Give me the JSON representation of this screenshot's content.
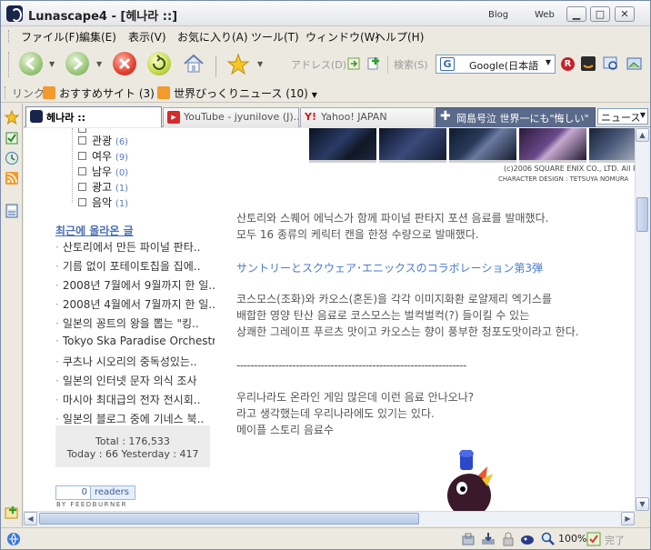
{
  "window": {
    "title": "Lunascape4 - [헤나라 ::]",
    "mode_blog": "Blog",
    "mode_web": "Web",
    "controls": {
      "minimize": "▁",
      "maximize": "□",
      "close": "✕"
    }
  },
  "menu": [
    "ファイル(F)",
    "編集(E)",
    "表示(V)",
    "お気に入り(A)",
    "ツール(T)",
    "ウィンドウ(W)",
    "ヘルプ(H)"
  ],
  "toolbar": {
    "address_label": "アドレス(D)",
    "search_label": "検索(S)",
    "search_engine": "Google(日本語"
  },
  "links": {
    "label": "リンク",
    "items": [
      "おすすめサイト (3)",
      "世界びっくりニュース (10)"
    ]
  },
  "tabs": [
    {
      "label": "헤나라 ::",
      "active": true
    },
    {
      "label": "YouTube - jyunilove (J)...",
      "active": false
    },
    {
      "label": "Yahoo! JAPAN",
      "active": false
    },
    {
      "label": "岡島号泣 世界一にも\"悔しい\"",
      "active": false
    }
  ],
  "news_select": "ニュース",
  "categories": [
    {
      "name": "관광",
      "count": "(6)"
    },
    {
      "name": "여우",
      "count": "(9)"
    },
    {
      "name": "남우",
      "count": "(0)"
    },
    {
      "name": "광고",
      "count": "(1)"
    },
    {
      "name": "음악",
      "count": "(1)"
    }
  ],
  "recent": {
    "title": "최근에 올라온 글",
    "posts": [
      "산토리에서 만든 파이널 판타..",
      "기름 없이 포테이토칩을 집에..",
      "2008년 7월에서 9월까지 한 일..",
      "2008년 4월에서 7월까지 한 일..",
      "일본의 꽁트의 왕을 뽑는 \"킹..",
      "Tokyo Ska Paradise Orchestra",
      "쿠츠나 시오리의 중독성있는..",
      "일본의 인터넷 문자 의식 조사",
      "마시아 최대급의 전자 전시회..",
      "일본의 블로그 중에 기네스 북.."
    ]
  },
  "counter": {
    "total": "Total : 176,533",
    "today": "Today : 66 Yesterday : 417"
  },
  "feedburner": {
    "count": "0",
    "readers": "readers",
    "by": "BY FEEDBURNER"
  },
  "banner": {
    "copyright": "(c)2006 SQUARE ENIX CO., LTD. All Rig",
    "credit": "CHARACTER DESIGN : TETSUYA NOMURA"
  },
  "article": {
    "p1": "산토리와 스퀘어 에닉스가 함께 파이널 판타지 포션 음료를 발매했다.",
    "p2": "모두 16 종류의 케릭터 캔을 한정 수량으로 발매했다.",
    "jp": "サントリーとスクウェア･エニックスのコラボレーション第3弾",
    "p3": "코스모스(조화)와 카오스(혼돈)을 각각 이미지화환 로얄제리 엑기스를",
    "p4": "배합한 영양 탄산 음료로 코스모스는 벌컥벌컥(?) 들이킬 수 있는",
    "p5": "상쾌한 그레이프 푸르츠 맛이고 카오스는 향이 풍부한 청포도맛이라고 한다.",
    "divider": "------------------------------------------------------------------",
    "p6": "우리나라도 온라인 게임 많은데 이런 음료 안나오나?",
    "p7": "라고 생각했는데 우리나라에도 있기는 있다.",
    "p8": "메이플 스토리 음료수"
  },
  "status": {
    "zoom": "100%",
    "done": "完了"
  },
  "colors": {
    "link_blue": "#4a6fb5",
    "jp_blue": "#4a7ad0",
    "count_blue": "#5a7ac2"
  }
}
